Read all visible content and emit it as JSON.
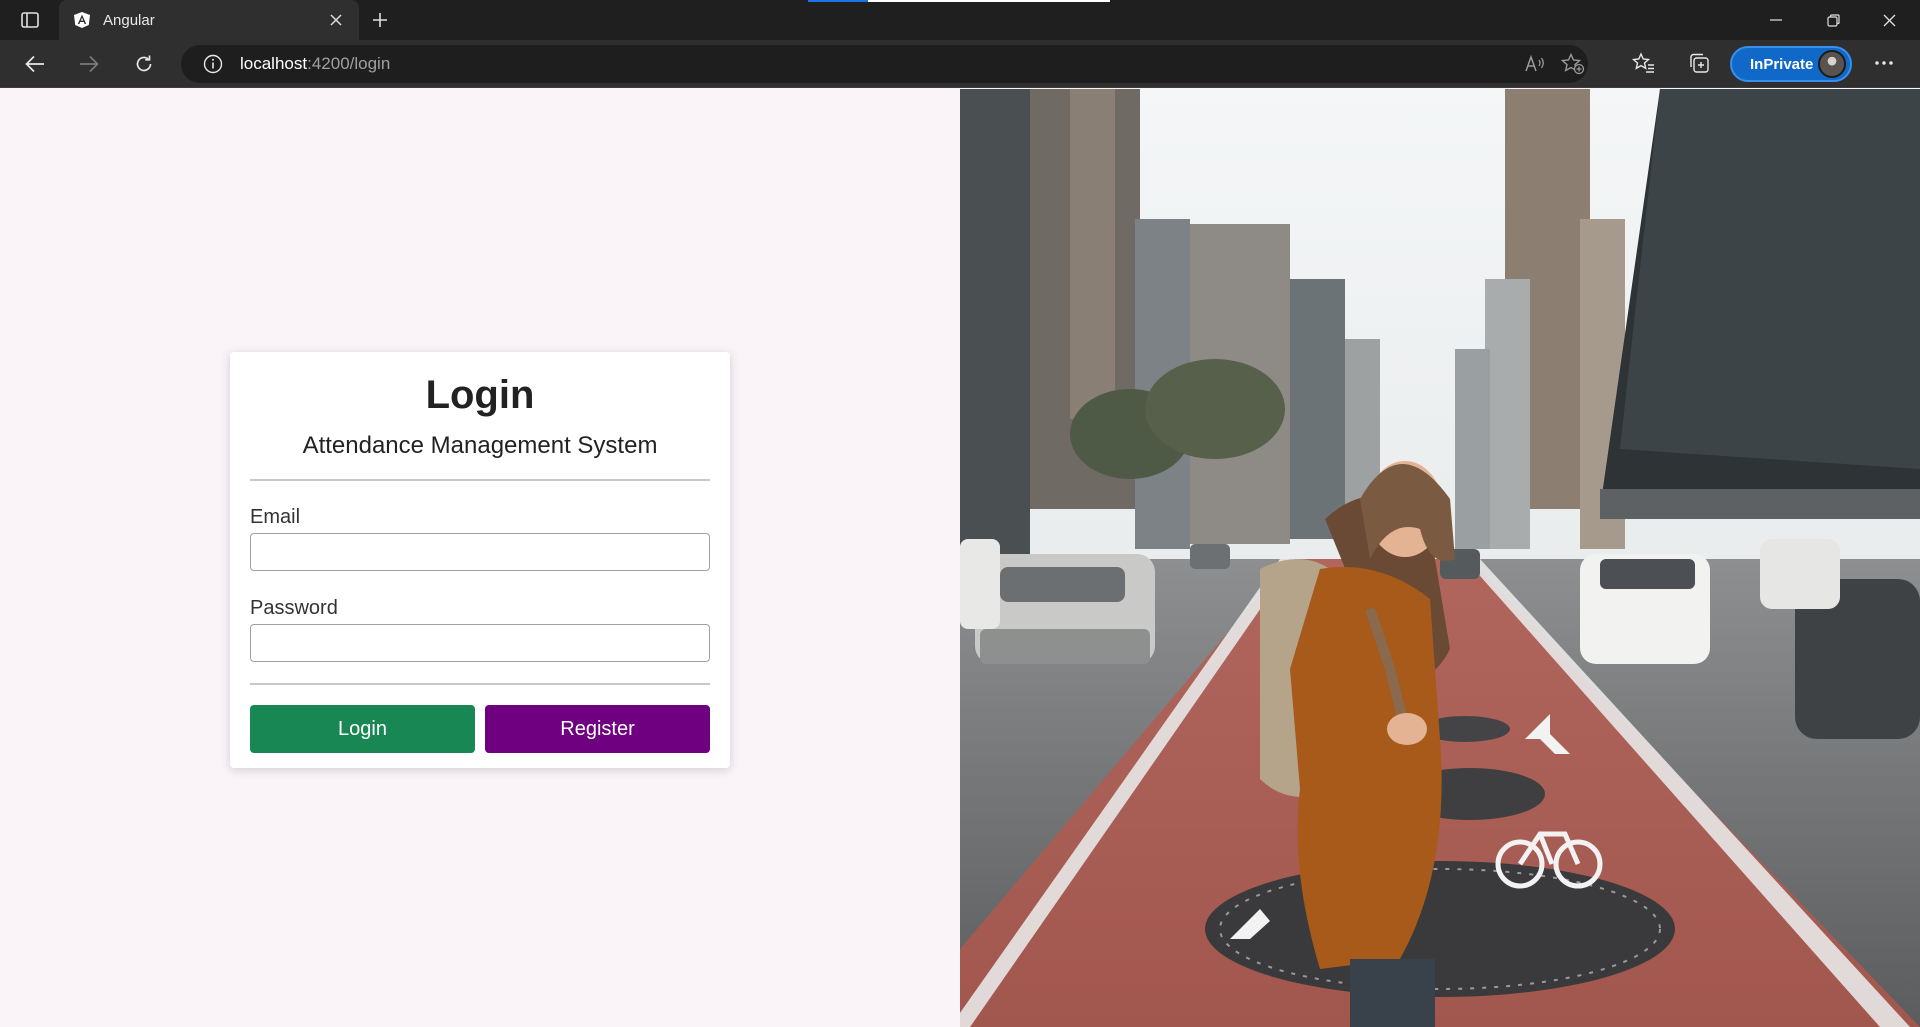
{
  "browser": {
    "tab_title": "Angular",
    "url_host": "localhost",
    "url_rest": ":4200/login",
    "inprivate_label": "InPrivate"
  },
  "login": {
    "title": "Login",
    "subtitle": "Attendance Management System",
    "email_label": "Email",
    "email_value": "",
    "password_label": "Password",
    "password_value": "",
    "login_button": "Login",
    "register_button": "Register"
  },
  "colors": {
    "page_bg": "#faf4f9",
    "login_button": "#198754",
    "register_button": "#6f0080",
    "inprivate_badge": "#1068c8"
  },
  "icons": {
    "tab_actions": "tab-actions-icon",
    "favicon": "angular-logo-icon",
    "back": "back-arrow-icon",
    "forward": "forward-arrow-icon",
    "refresh": "refresh-icon",
    "site_info": "info-icon",
    "read_aloud": "read-aloud-icon",
    "add_favorite": "add-favorite-icon",
    "favorites": "favorites-icon",
    "collections": "collections-icon",
    "more": "more-icon"
  }
}
